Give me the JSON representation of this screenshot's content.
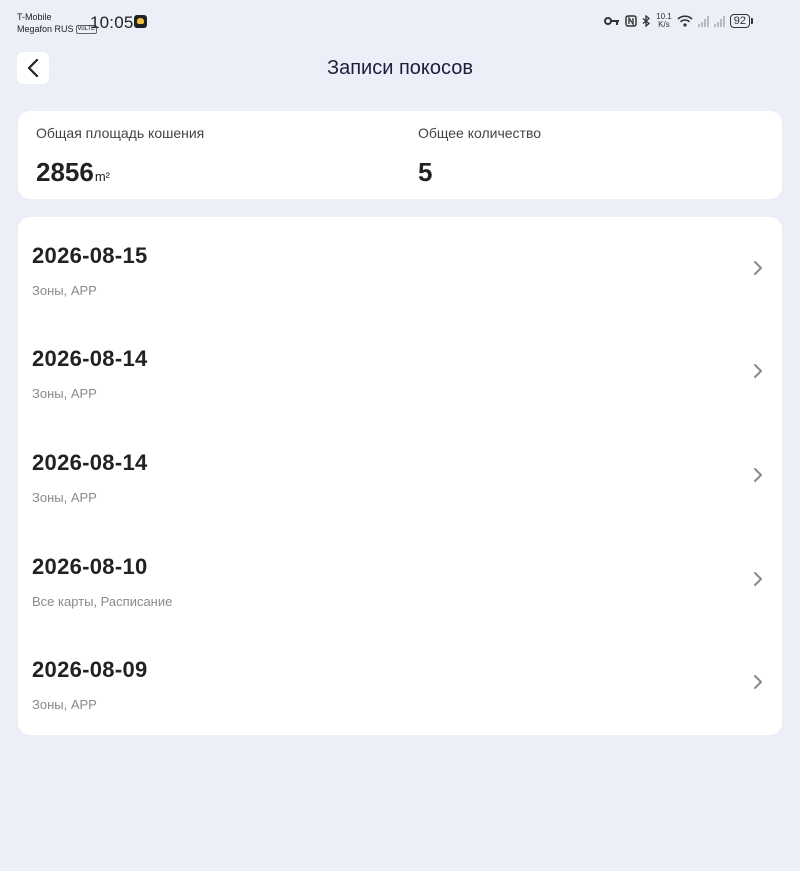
{
  "status_bar": {
    "carrier_1": "T-Mobile",
    "carrier_2": "Megafon RUS",
    "volte": "VoLTE",
    "time": "10:05",
    "net_speed_value": "10.1",
    "net_speed_unit": "K/s",
    "battery": "92"
  },
  "header": {
    "title": "Записи покосов",
    "back_icon": "chevron-left-icon"
  },
  "summary": {
    "area_label": "Общая площадь кошения",
    "area_value": "2856",
    "area_unit": "m²",
    "count_label": "Общее количество",
    "count_value": "5"
  },
  "records": [
    {
      "date": "2026-08-15",
      "subtitle": "Зоны, APP"
    },
    {
      "date": "2026-08-14",
      "subtitle": "Зоны, APP"
    },
    {
      "date": "2026-08-14",
      "subtitle": "Зоны, APP"
    },
    {
      "date": "2026-08-10",
      "subtitle": "Все карты, Расписание"
    },
    {
      "date": "2026-08-09",
      "subtitle": "Зоны, APP"
    }
  ],
  "colors": {
    "background": "#eceef8",
    "card": "#ffffff",
    "title": "#1d1e3a",
    "subtitle": "#8a8a8a"
  }
}
